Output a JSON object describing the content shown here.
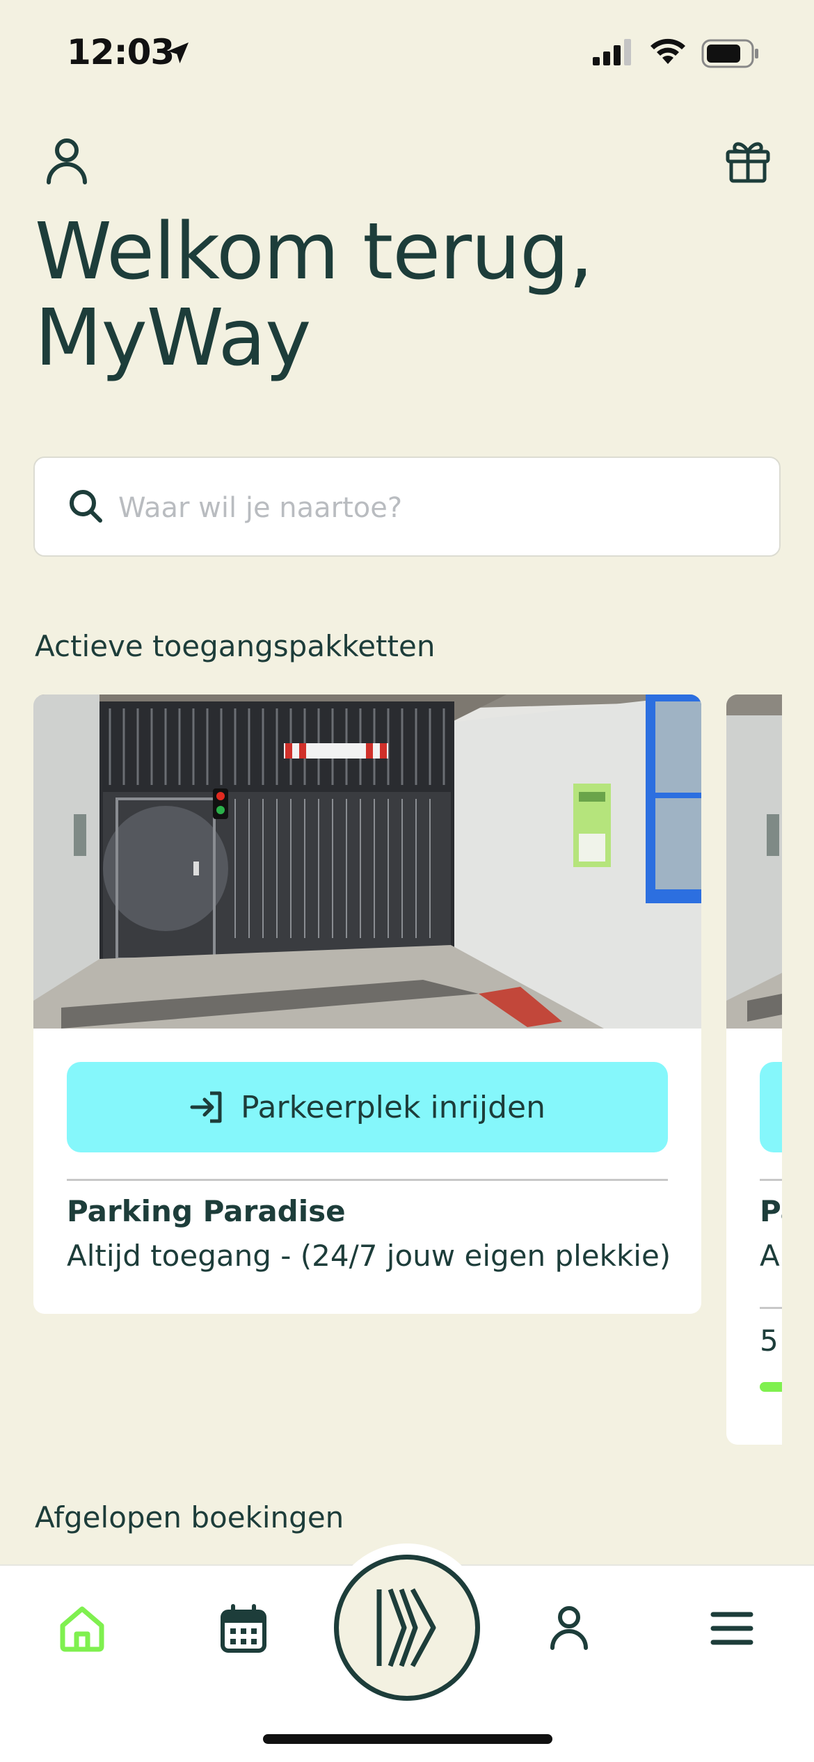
{
  "status_bar": {
    "time": "12:03",
    "icons": [
      "location-arrow-icon",
      "cellular-signal-icon",
      "wifi-icon",
      "battery-icon"
    ]
  },
  "header": {
    "welcome_line1": "Welkom terug,",
    "welcome_line2": "MyWay",
    "icons": [
      "user-icon",
      "gift-icon"
    ]
  },
  "search": {
    "placeholder": "Waar wil je naartoe?",
    "value": ""
  },
  "sections": {
    "active_packages": "Actieve toegangspakketten",
    "past_bookings": "Afgelopen boekingen"
  },
  "active_cards": [
    {
      "button_label": "Parkeerplek inrijden",
      "name": "Parking Paradise",
      "description": "Altijd toegang - (24/7 jouw eigen plekkie)"
    },
    {
      "name_partial": "Pa",
      "description_partial": "A",
      "count_partial": "5"
    }
  ],
  "bottom_nav": {
    "items": [
      "home-icon",
      "calendar-icon",
      "myway-logo-icon",
      "profile-icon",
      "menu-icon"
    ],
    "active": "home",
    "active_color": "#7ff04f"
  },
  "colors": {
    "background": "#f3f1e1",
    "text_dark": "#1d3d3a",
    "button_cyan": "#85f7fb",
    "accent_green": "#7ff04f"
  }
}
